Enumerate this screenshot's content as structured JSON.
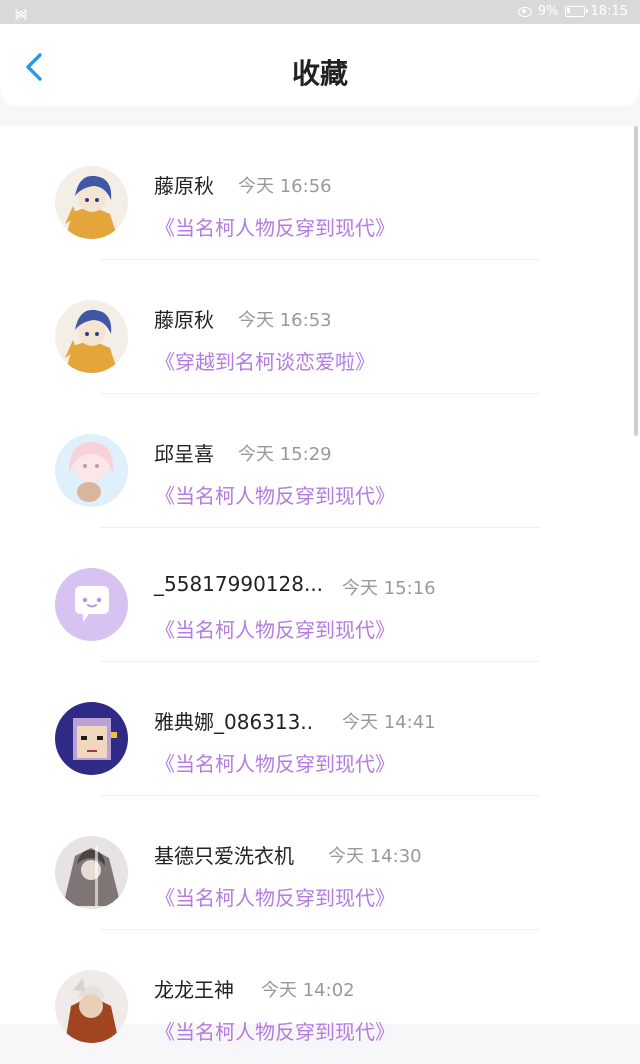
{
  "status_bar": {
    "battery_percent": "9%",
    "time": "18:15"
  },
  "header": {
    "title": "收藏",
    "back_icon": "chevron-left-icon"
  },
  "items": [
    {
      "name": "藤原秋",
      "time": "今天 16:56",
      "novel": "《当名柯人物反穿到现代》",
      "avatar": "anime-blue-hair-avatar"
    },
    {
      "name": "藤原秋",
      "time": "今天 16:53",
      "novel": "《穿越到名柯谈恋爱啦》",
      "avatar": "anime-blue-hair-avatar"
    },
    {
      "name": "邱呈喜",
      "time": "今天 15:29",
      "novel": "《当名柯人物反穿到现代》",
      "avatar": "anime-pink-girl-avatar"
    },
    {
      "name": "_55817990128...",
      "time": "今天 15:16",
      "novel": "《当名柯人物反穿到现代》",
      "avatar": "default-chat-avatar"
    },
    {
      "name": "雅典娜_086313..",
      "time": "今天 14:41",
      "novel": "《当名柯人物反穿到现代》",
      "avatar": "pixel-purple-hair-avatar"
    },
    {
      "name": "基德只爱洗衣机",
      "time": "今天 14:30",
      "novel": "《当名柯人物反穿到现代》",
      "avatar": "grey-anime-avatar"
    },
    {
      "name": "龙龙王神",
      "time": "今天 14:02",
      "novel": "《当名柯人物反穿到现代》",
      "avatar": "warrior-avatar"
    }
  ],
  "colors": {
    "accent": "#2a9be8",
    "link": "#b47be0",
    "time": "#999999"
  }
}
